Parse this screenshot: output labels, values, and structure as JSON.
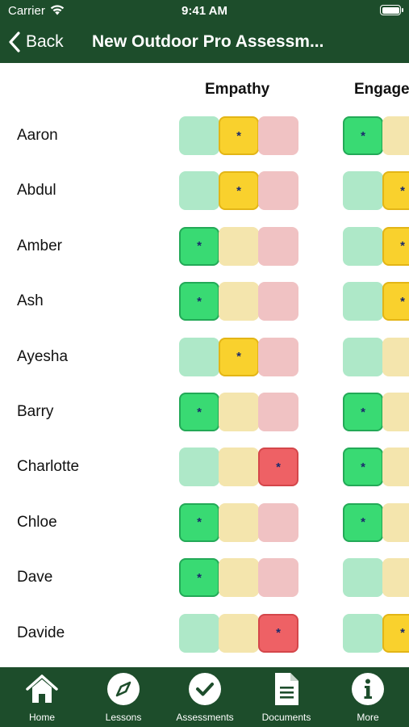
{
  "status_bar": {
    "carrier": "Carrier",
    "time": "9:41 AM"
  },
  "nav": {
    "back_label": "Back",
    "title": "New Outdoor Pro Assessm..."
  },
  "columns": [
    "Empathy",
    "Engage"
  ],
  "students": [
    {
      "name": "Aaron",
      "selected": [
        "yellow",
        "green"
      ]
    },
    {
      "name": "Abdul",
      "selected": [
        "yellow",
        "yellow"
      ]
    },
    {
      "name": "Amber",
      "selected": [
        "green",
        "yellow"
      ]
    },
    {
      "name": "Ash",
      "selected": [
        "green",
        "yellow"
      ]
    },
    {
      "name": "Ayesha",
      "selected": [
        "yellow",
        "none"
      ]
    },
    {
      "name": "Barry",
      "selected": [
        "green",
        "green"
      ]
    },
    {
      "name": "Charlotte",
      "selected": [
        "red",
        "green"
      ]
    },
    {
      "name": "Chloe",
      "selected": [
        "green",
        "green"
      ]
    },
    {
      "name": "Dave",
      "selected": [
        "green",
        "none"
      ]
    },
    {
      "name": "Davide",
      "selected": [
        "red",
        "yellow"
      ]
    }
  ],
  "selected_marker": "*",
  "tabs": [
    {
      "label": "Home",
      "icon": "home-icon"
    },
    {
      "label": "Lessons",
      "icon": "compass-icon"
    },
    {
      "label": "Assessments",
      "icon": "checkmark-icon"
    },
    {
      "label": "Documents",
      "icon": "document-icon"
    },
    {
      "label": "More",
      "icon": "info-icon"
    }
  ],
  "colors": {
    "bar": "#1d4d2b",
    "green": "#39da73",
    "yellow": "#f9d12d",
    "red": "#ee6165"
  }
}
